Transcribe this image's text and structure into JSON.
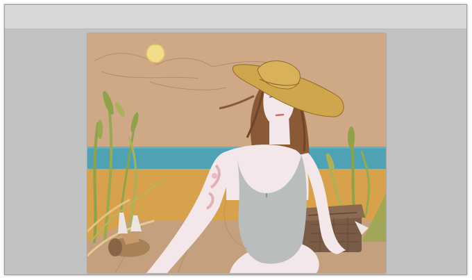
{
  "app": {
    "title": ""
  },
  "canvas": {
    "artwork_label": "",
    "colors": {
      "sky": "#cfa886",
      "sea": "#4fa2b3",
      "sand": "#d7a24b",
      "blanket": "#c4a07e",
      "hat": "#d0a64c",
      "hair": "#8a5a36",
      "skin": "#f3e7ea",
      "swimsuit": "#b9bdbc",
      "grass": "#8fa24a",
      "basket": "#7a5b45",
      "sun": "#f2dc8a"
    }
  }
}
